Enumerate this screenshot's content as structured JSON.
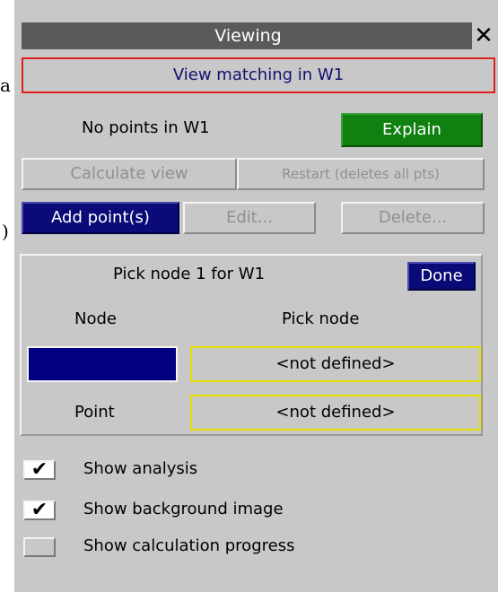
{
  "stray": {
    "top_text": "a",
    "mid_text": ")"
  },
  "window": {
    "title": "Viewing",
    "close_glyph": "✕"
  },
  "mode_button": "View matching in W1",
  "status": {
    "text": "No points in W1",
    "explain_button": "Explain"
  },
  "actions": {
    "calculate": "Calculate view",
    "restart": "Restart (deletes all pts)",
    "add": "Add point(s)",
    "edit": "Edit...",
    "delete": "Delete..."
  },
  "pick": {
    "prompt": "Pick node 1 for W1",
    "done": "Done",
    "node_header": "Node",
    "pick_header": "Pick node",
    "node_value": "<not defined>",
    "point_label": "Point",
    "point_value": "<not defined>",
    "swatch_color": "#000080"
  },
  "options": [
    {
      "label": "Show analysis",
      "checked": true
    },
    {
      "label": "Show background image",
      "checked": true
    },
    {
      "label": "Show calculation progress",
      "checked": false
    }
  ]
}
